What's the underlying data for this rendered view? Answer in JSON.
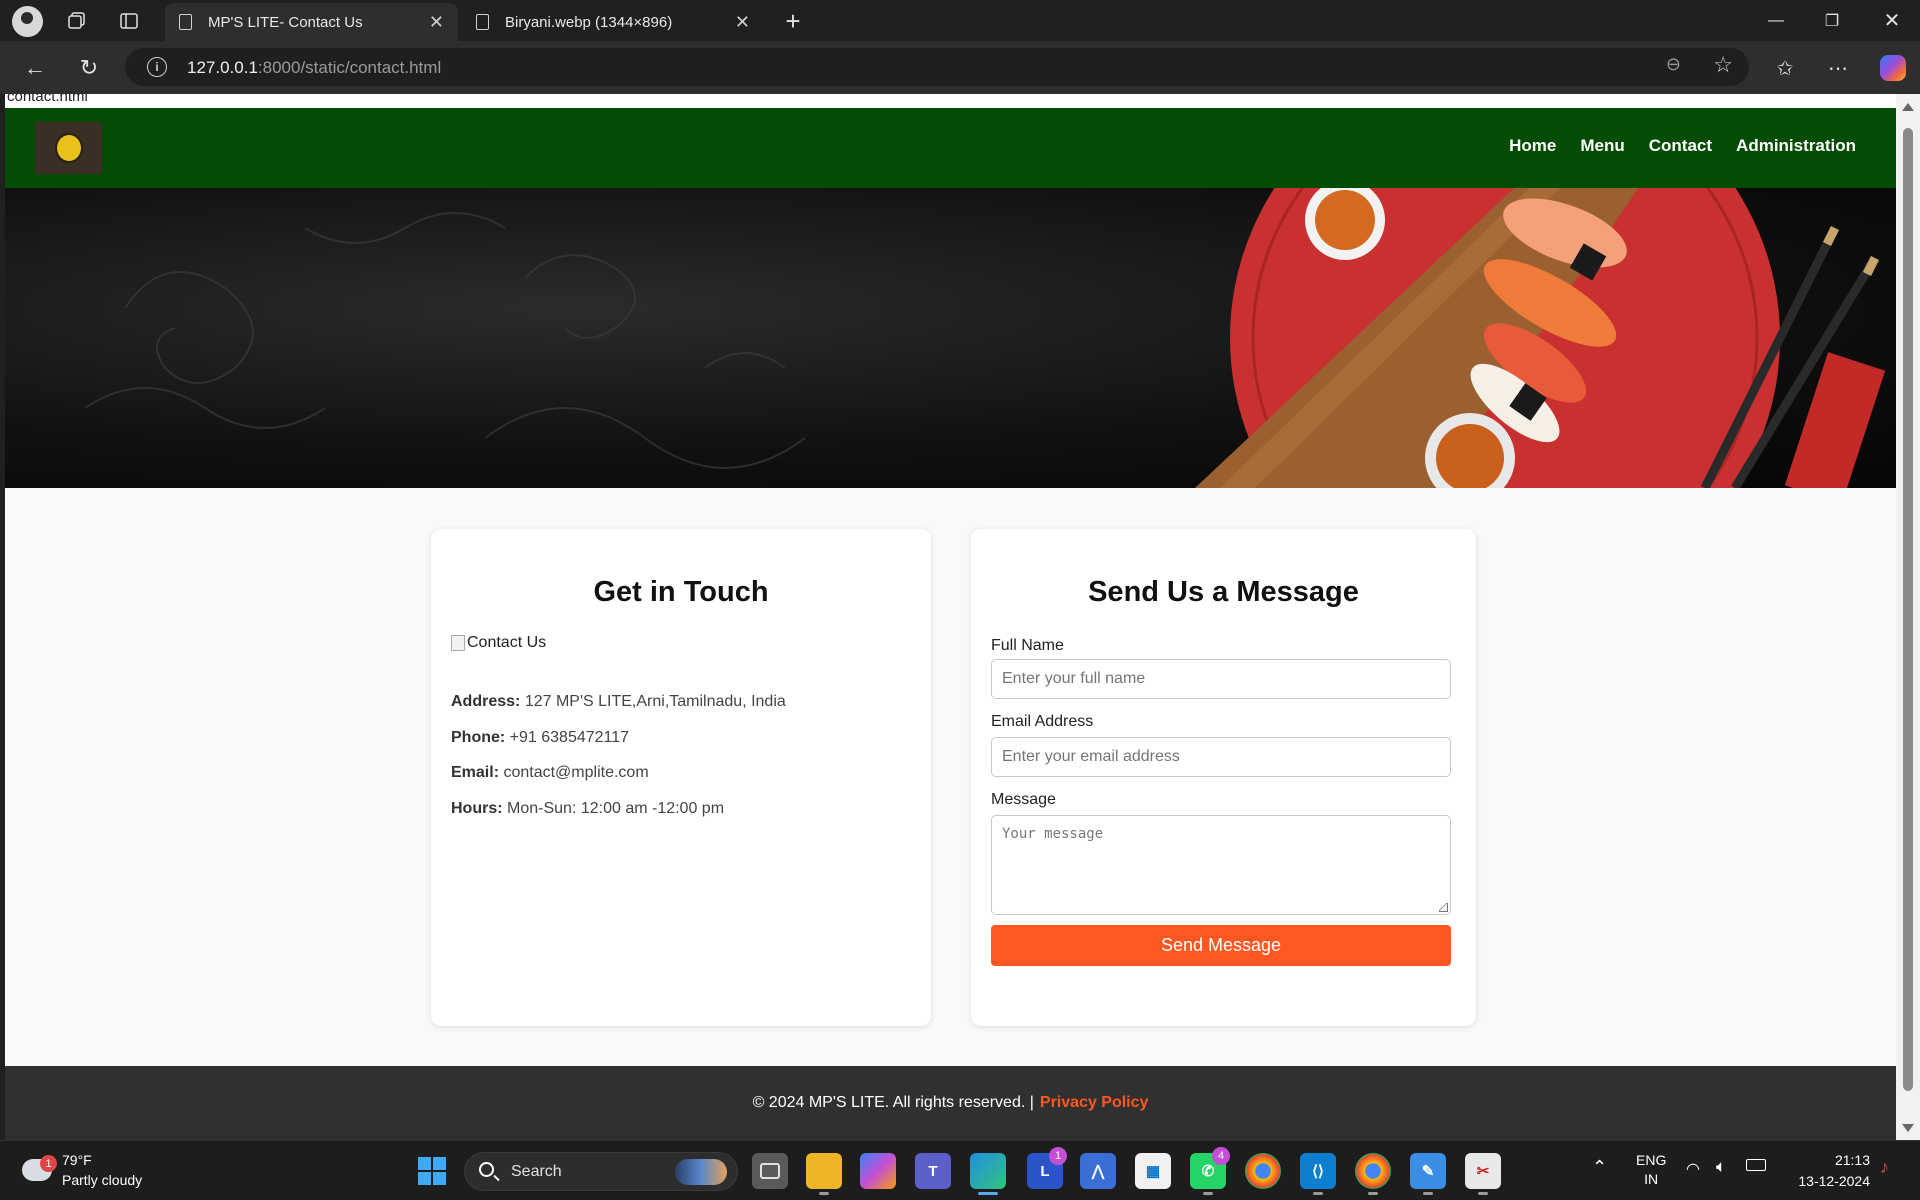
{
  "browser": {
    "tabs": [
      {
        "title": "MP'S LITE- Contact Us",
        "active": true
      },
      {
        "title": "Biryani.webp (1344×896)",
        "active": false
      }
    ],
    "url_host": "127.0.0.1",
    "url_rest": ":8000/static/contact.html",
    "status_tip": "contact.html"
  },
  "site": {
    "nav": [
      "Home",
      "Menu",
      "Contact",
      "Administration"
    ],
    "contact_card": {
      "title": "Get in Touch",
      "image_alt": "Contact Us",
      "address_label": "Address:",
      "address": "127 MP'S LITE,Arni,Tamilnadu, India",
      "phone_label": "Phone:",
      "phone": "+91 6385472117",
      "email_label": "Email:",
      "email": "contact@mplite.com",
      "hours_label": "Hours:",
      "hours": "Mon-Sun: 12:00 am -12:00 pm"
    },
    "form": {
      "title": "Send Us a Message",
      "name_label": "Full Name",
      "name_placeholder": "Enter your full name",
      "email_label": "Email Address",
      "email_placeholder": "Enter your email address",
      "message_label": "Message",
      "message_placeholder": "Your message",
      "submit_label": "Send Message"
    },
    "footer": {
      "copyright": "© 2024 MP'S LITE. All rights reserved. |",
      "privacy_link": "Privacy Policy"
    },
    "colors": {
      "header_green": "#044b03",
      "accent_orange": "#fe5721",
      "footer_dark": "#303030"
    }
  },
  "taskbar": {
    "weather_temp": "79°F",
    "weather_desc": "Partly cloudy",
    "weather_badge": "1",
    "search_label": "Search",
    "app_badges": {
      "l_app": "1",
      "whatsapp": "4"
    },
    "lang_top": "ENG",
    "lang_bottom": "IN",
    "time": "21:13",
    "date": "13-12-2024"
  }
}
